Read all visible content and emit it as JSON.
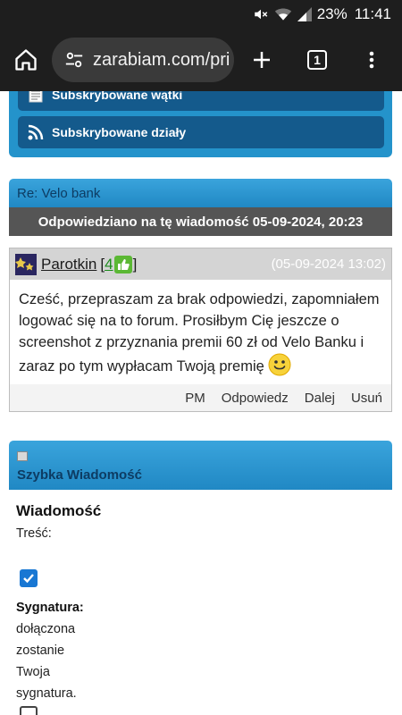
{
  "status_bar": {
    "battery": "23%",
    "time": "11:41",
    "icons": [
      "mute-icon",
      "wifi-icon",
      "signal-icon"
    ]
  },
  "browser": {
    "url": "zarabiam.com/pri",
    "tab_count": "1"
  },
  "menu": {
    "items": [
      {
        "label": "Subskrybowane wątki",
        "icon": "document-icon"
      },
      {
        "label": "Subskrybowane działy",
        "icon": "rss-icon"
      }
    ]
  },
  "thread": {
    "title": "Re: Velo bank",
    "answered": "Odpowiedziano na tę wiadomość 05-09-2024, 20:23"
  },
  "post": {
    "username": "Parotkin",
    "rep_open": "[",
    "reputation": "4",
    "rep_close": "]",
    "date": "(05-09-2024 13:02)",
    "body": "Cześć, przepraszam za brak odpowiedzi, zapomniałem logować się na to forum. Prosiłbym Cię jeszcze o screenshot z przyznania premii 60 zł od Velo Banku i zaraz po tym wypłacam Twoją premię",
    "actions": [
      "PM",
      "Odpowiedz",
      "Dalej",
      "Usuń"
    ]
  },
  "quick_reply": {
    "title": "Szybka Wiadomość",
    "heading": "Wiadomość",
    "content_label": "Treść:",
    "signature_label": "Sygnatura:",
    "signature_text": [
      "dołączona",
      "zostanie",
      "Twoja",
      "sygnatura."
    ],
    "signature_checked": true
  },
  "colors": {
    "accent_blue": "#2493cb",
    "dark_button": "#145a8c",
    "answered_bar": "#555555"
  }
}
